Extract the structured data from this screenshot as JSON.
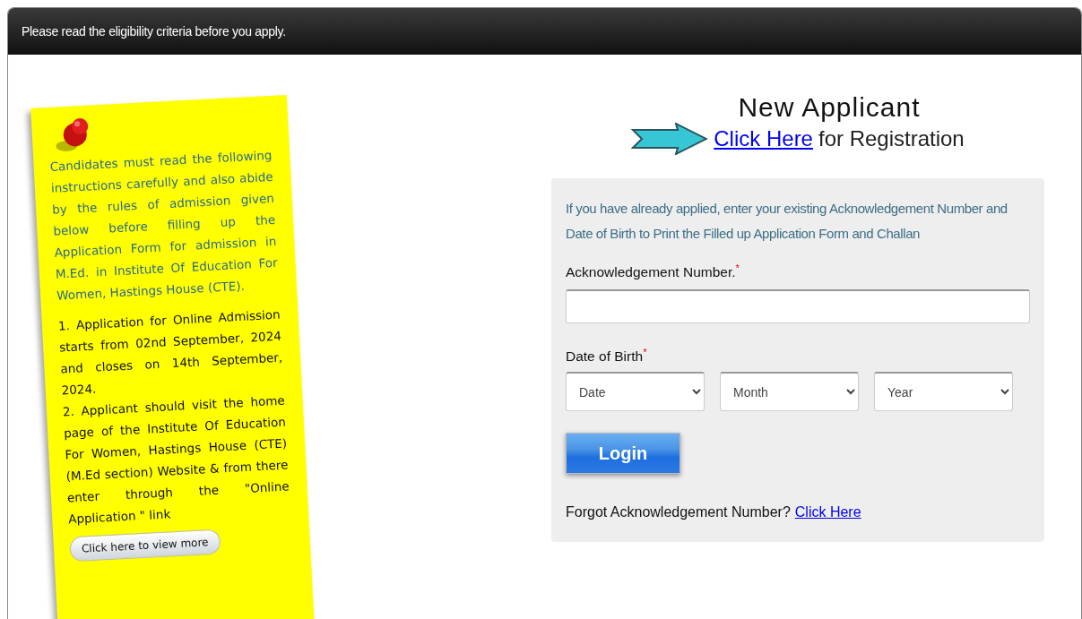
{
  "header": {
    "notice": "Please read the eligibility criteria before you apply."
  },
  "note": {
    "intro": "Candidates must read the following instructions carefully and also abide by the rules of admission given below before filling up the Application Form for admission in M.Ed. in Institute Of Education For Women, Hastings House (CTE).",
    "items": [
      "1. Application for Online Admission starts from 02nd September, 2024 and closes on 14th September, 2024.",
      "2. Applicant should visit the home page of the Institute Of Education For Women, Hastings House (CTE) (M.Ed section) Website & from there enter through the \"Online Application \" link"
    ],
    "more_button": "Click here to view more"
  },
  "new_applicant": {
    "title": "New Applicant",
    "link": "Click Here",
    "link_suffix": "for Registration"
  },
  "login": {
    "intro": "If you have already applied, enter your existing Acknowledgement Number and Date of Birth to Print the Filled up Application Form and Challan",
    "ack_label": "Acknowledgement Number.",
    "ack_required": "*",
    "dob_label": "Date of Birth",
    "dob_required": "*",
    "dob_selects": [
      {
        "placeholder": "Date"
      },
      {
        "placeholder": "Month"
      },
      {
        "placeholder": "Year"
      }
    ],
    "button": "Login",
    "forgot_text": "Forgot Acknowledgement Number?",
    "forgot_link": "Click Here"
  }
}
